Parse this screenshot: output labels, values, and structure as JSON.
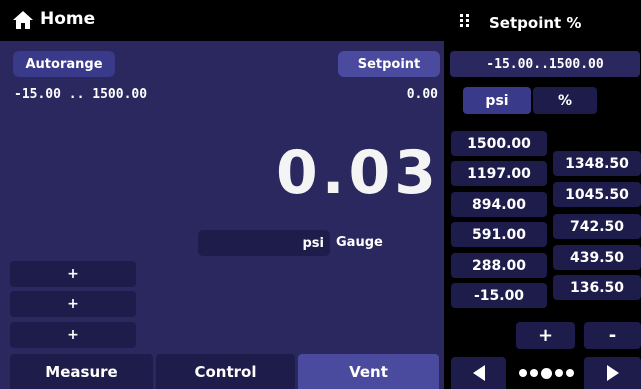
{
  "header": {
    "title": "Home",
    "icon": "home-icon"
  },
  "left": {
    "autorange_label": "Autorange",
    "setpoint_label": "Setpoint",
    "range_text": "-15.00 .. 1500.00",
    "setpoint_value": "0.00",
    "reading": "0.03",
    "unit": "psi",
    "mode": "Gauge",
    "plus_buttons": [
      "+",
      "+",
      "+"
    ],
    "tabs": {
      "measure": "Measure",
      "control": "Control",
      "vent": "Vent"
    }
  },
  "right": {
    "title": "Setpoint %",
    "icon": "grid-icon",
    "range": "-15.00..1500.00",
    "units": {
      "psi": "psi",
      "percent": "%"
    },
    "presets_left": [
      "1500.00",
      "1197.00",
      "894.00",
      "591.00",
      "288.00",
      "-15.00"
    ],
    "presets_right": [
      "1348.50",
      "1045.50",
      "742.50",
      "439.50",
      "136.50"
    ],
    "plus_label": "+",
    "minus_label": "-",
    "page_dots": 5,
    "active_page": 3
  },
  "colors": {
    "panel": "#2a285e",
    "button": "#1e1c4a",
    "active": "#4a4a9e"
  }
}
